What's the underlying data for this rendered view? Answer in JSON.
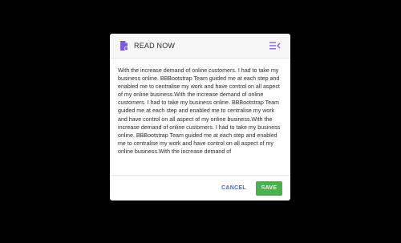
{
  "modal": {
    "title": "READ NOW",
    "header_icon": "document-icon",
    "menu_icon": "menu-collapse-icon",
    "accent_color": "#7b5ce1",
    "body_text": "With the increase demand of online customers. I had to take my business online. BBBootstrap Team guided me at each step and enabled me to centralise my work and have control on all aspect of my online business.With the increase demand of online customers. I had to take my business online. BBBootstrap Team guided me at each step and enabled me to centralise my work and have control on all aspect of my online business.With the increase demand of online customers. I had to take my business online. BBBootstrap Team guided me at each step and enabled me to centralise my work and have control on all aspect of my online business.With the increase demand of"
  },
  "footer": {
    "cancel_label": "CANCEL",
    "save_label": "SAVE",
    "cancel_color": "#3f6bd9",
    "save_color": "#4caf50"
  }
}
